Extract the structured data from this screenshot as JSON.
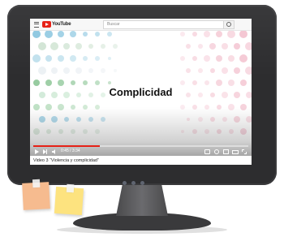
{
  "youtube": {
    "logo_text": "YouTube",
    "search_placeholder": "Buscar"
  },
  "video": {
    "title": "Complicidad",
    "time": "0:45 / 3:34",
    "progress": 0.31
  },
  "caption": "Video 3 “Violencia y complicidad”",
  "colors": {
    "monitor": "#2d2d2f",
    "youtube_red": "#e62117",
    "note_peach": "#f6bb8f",
    "note_yellow": "#fde37f"
  }
}
